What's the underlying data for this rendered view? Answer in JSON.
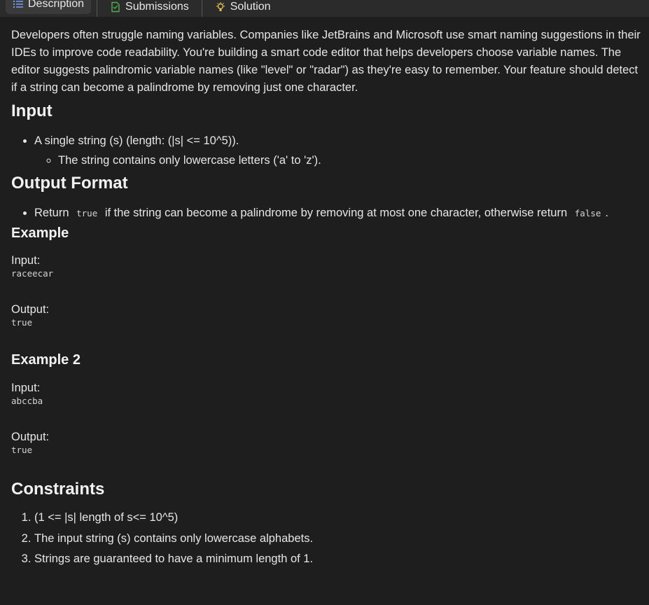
{
  "tabs": [
    {
      "label": "Description",
      "icon": "list-icon",
      "active": true
    },
    {
      "label": "Submissions",
      "icon": "submissions-icon",
      "active": false
    },
    {
      "label": "Solution",
      "icon": "lightbulb-icon",
      "active": false
    }
  ],
  "colors": {
    "background": "#1e1e1e",
    "tabbar": "#2b2b2b",
    "active_tab": "#3a3a3a",
    "submissions_icon": "#4caf50",
    "solution_icon": "#e0c050"
  },
  "description": "Developers often struggle naming variables. Companies like JetBrains and Microsoft use smart naming suggestions in their IDEs to improve code readability. You're building a smart code editor that helps developers choose variable names. The editor suggests palindromic variable names (like \"level\" or \"radar\") as they're easy to remember. Your feature should detect if a string can become a palindrome by removing just one character.",
  "input": {
    "heading": "Input",
    "item": "A single string (s) (length: (|s|  <= 10^5)).",
    "subitem": "The string contains only lowercase letters ('a' to 'z')."
  },
  "output_format": {
    "heading": "Output Format",
    "prefix": "Return",
    "code_true": "true",
    "middle": "if the string can become a palindrome by removing at most one character, otherwise return",
    "code_false": "false",
    "suffix": "."
  },
  "example1": {
    "heading": "Example",
    "input_label": "Input:",
    "input_value": "raceecar",
    "output_label": "Output:",
    "output_value": "true"
  },
  "example2": {
    "heading": "Example 2",
    "input_label": "Input:",
    "input_value": "abccba",
    "output_label": "Output:",
    "output_value": "true"
  },
  "constraints": {
    "heading": "Constraints",
    "items": [
      "(1 <= |s| length of s<= 10^5)",
      "The input string (s) contains only lowercase alphabets.",
      "Strings are guaranteed to have a minimum length of 1."
    ]
  }
}
